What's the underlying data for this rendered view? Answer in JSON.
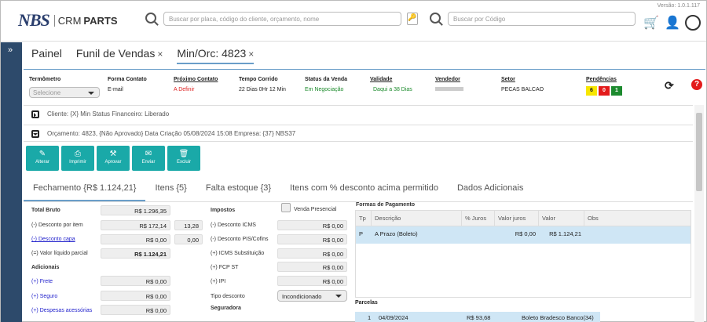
{
  "header": {
    "version": "Versão: 1.0.1.117",
    "logo_main": "NBS",
    "logo_crm": "CRM",
    "logo_parts": "PARTS",
    "search_placeholder": "Buscar por placa, código do cliente, orçamento, nome",
    "search2_placeholder": "Buscar por Código"
  },
  "sidebar": {
    "toggle": "»"
  },
  "tabs": [
    {
      "label": "Painel"
    },
    {
      "label": "Funil de Vendas",
      "close": "×"
    },
    {
      "label": "Min/Orc: 4823",
      "close": "×"
    }
  ],
  "info": {
    "termometro": {
      "label": "Termômetro",
      "value": "Selecione"
    },
    "forma_contato": {
      "label": "Forma Contato",
      "value": "E-mail"
    },
    "proximo_contato": {
      "label": "Próximo Contato",
      "value": "A Definir"
    },
    "tempo_corrido": {
      "label": "Tempo Corrido",
      "value": "22 Dias 0Hr 12 Min"
    },
    "status_venda": {
      "label": "Status da Venda",
      "value": "Em Negociação"
    },
    "validade": {
      "label": "Validade",
      "value": "Daqui a 38 Dias"
    },
    "vendedor": {
      "label": "Vendedor",
      "value": ""
    },
    "setor": {
      "label": "Setor",
      "value": "PECAS BALCAO"
    },
    "pendencias": {
      "label": "Pendências",
      "values": [
        "6",
        "0",
        "1"
      ],
      "colors": [
        "#f7e600",
        "#e31b1b",
        "#1c8a2e"
      ]
    }
  },
  "rows": {
    "cliente": "Cliente: {X} Min            Status Financeiro: Liberado",
    "orcamento": "Orçamento: 4823, {Não Aprovado} Data Criação 05/08/2024 15:08 Empresa: {37} NBS37"
  },
  "actions": [
    {
      "label": "Alterar",
      "icon": "✎"
    },
    {
      "label": "Imprimir",
      "icon": "⎙"
    },
    {
      "label": "Aprovar",
      "icon": "⚒"
    },
    {
      "label": "Enviar",
      "icon": "✉"
    },
    {
      "label": "Excluir",
      "icon": "🗑"
    }
  ],
  "subtabs": [
    "Fechamento {R$ 1.124,21}",
    "Itens {5}",
    "Falta estoque {3}",
    "Itens com % desconto acima permitido",
    "Dados Adicionais"
  ],
  "totals": {
    "total_bruto": {
      "label": "Total Bruto",
      "value": "R$ 1.296,35"
    },
    "desc_item": {
      "label": "(-) Desconto por item",
      "value": "R$ 172,14",
      "pct": "13,28"
    },
    "desc_capa": {
      "label": "(-) Desconto capa",
      "value": "R$ 0,00",
      "pct": "0,00"
    },
    "liquido": {
      "label": "(=) Valor líquido parcial",
      "value": "R$ 1.124,21"
    },
    "adicionais": "Adicionais",
    "frete": {
      "label": "(+) Frete",
      "value": "R$ 0,00"
    },
    "seguro": {
      "label": "(+) Seguro",
      "value": "R$ 0,00"
    },
    "despesas": {
      "label": "(+) Despesas acessórias",
      "value": "R$ 0,00"
    }
  },
  "impostos": {
    "title": "Impostos",
    "venda_presencial": "Venda Presencial",
    "icms": {
      "label": "(-) Desconto ICMS",
      "value": "R$ 0,00"
    },
    "pis": {
      "label": "(-) Desconto PIS/Cofins",
      "value": "R$ 0,00"
    },
    "icms_st": {
      "label": "(+) ICMS Substituição",
      "value": "R$ 0,00"
    },
    "fcp": {
      "label": "(+) FCP ST",
      "value": "R$ 0,00"
    },
    "ipi": {
      "label": "(+) IPI",
      "value": "R$ 0,00"
    },
    "tipo_desconto": {
      "label": "Tipo desconto",
      "value": "Incondicionado"
    },
    "seguradora": "Seguradora"
  },
  "pagamento": {
    "title": "Formas de Pagamento",
    "headers": [
      "Tp",
      "Descrição",
      "% Juros",
      "Valor juros",
      "Valor",
      "Obs"
    ],
    "row": [
      "P",
      "A Prazo (Boleto)",
      "",
      "R$ 0,00",
      "R$ 1.124,21",
      ""
    ]
  },
  "parcelas": {
    "title": "Parcelas",
    "row": [
      "1",
      "04/09/2024",
      "R$ 93,68",
      "Boleto Bradesco Banco(34)"
    ]
  }
}
